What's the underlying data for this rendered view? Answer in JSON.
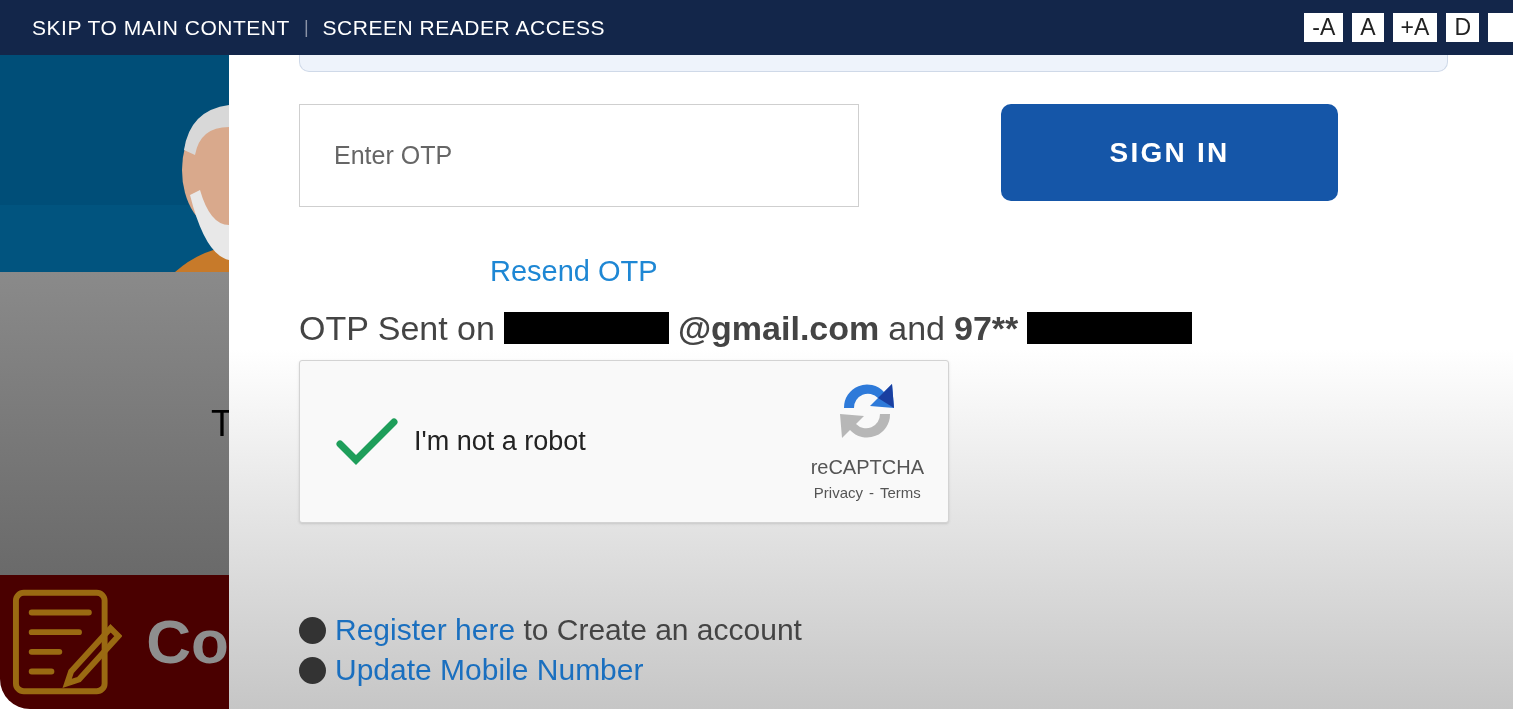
{
  "top_bar": {
    "links": [
      "SKIP TO MAIN CONTENT",
      "SCREEN READER ACCESS"
    ],
    "separator": "|",
    "font_buttons": [
      "-A",
      "A",
      "+A",
      "D"
    ]
  },
  "background": {
    "banner_text": "T",
    "tile_text": "Co"
  },
  "login": {
    "otp_field": {
      "placeholder": "Enter OTP"
    },
    "sign_in": "SIGN IN",
    "resend": "Resend OTP",
    "otp_sent": [
      {
        "kind": "text",
        "text": "OTP Sent on",
        "bold": false
      },
      {
        "kind": "redacted"
      },
      {
        "kind": "text",
        "text": "@gmail.com",
        "bold": true
      },
      {
        "kind": "text",
        "text": "and",
        "bold": false
      },
      {
        "kind": "text",
        "text": "97**",
        "bold": true
      },
      {
        "kind": "redacted"
      }
    ],
    "captcha": {
      "checked": true,
      "label": "I'm not a robot",
      "brand": "reCAPTCHA",
      "privacy": "Privacy",
      "dash": "-",
      "terms": "Terms"
    },
    "links": [
      {
        "link": "Register here",
        "rest": " to Create an account"
      },
      {
        "link": "Update Mobile Number"
      }
    ]
  }
}
